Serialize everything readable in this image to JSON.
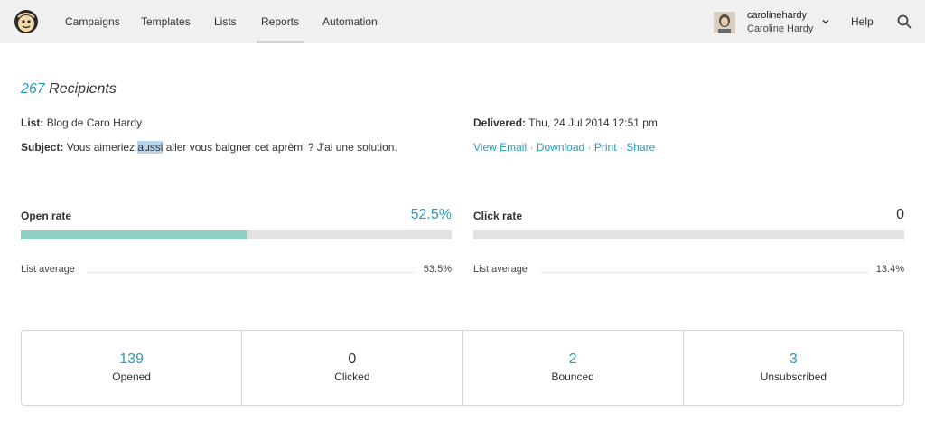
{
  "nav": {
    "items": [
      "Campaigns",
      "Templates",
      "Lists",
      "Reports",
      "Automation"
    ],
    "active": "Reports",
    "user_name": "carolinehardy",
    "user_full": "Caroline Hardy",
    "help": "Help"
  },
  "header": {
    "count": "267",
    "label": "Recipients",
    "list_label": "List:",
    "list_value": "Blog de Caro Hardy",
    "subject_label": "Subject:",
    "subject_before": "Vous aimeriez ",
    "subject_highlight": "aussi",
    "subject_after": " aller vous baigner cet aprèm' ? J'ai une solution.",
    "delivered_label": "Delivered:",
    "delivered_value": "Thu, 24 Jul 2014 12:51 pm",
    "links": [
      "View Email",
      "Download",
      "Print",
      "Share"
    ],
    "link_sep": "·"
  },
  "open_rate": {
    "label": "Open rate",
    "value": "52.5%",
    "fill": 0.525,
    "avg_label": "List average",
    "avg_value": "53.5%"
  },
  "click_rate": {
    "label": "Click rate",
    "value": "0",
    "fill": 0,
    "avg_label": "List average",
    "avg_value": "13.4%"
  },
  "stats": [
    {
      "value": "139",
      "label": "Opened",
      "color": "#2a9cb6"
    },
    {
      "value": "0",
      "label": "Clicked",
      "color": "#333333"
    },
    {
      "value": "2",
      "label": "Bounced",
      "color": "#2a9cb6"
    },
    {
      "value": "3",
      "label": "Unsubscribed",
      "color": "#2a9cb6"
    }
  ],
  "colors": {
    "accent": "#2a9cb6",
    "bar_fill": "#8fd0c4",
    "bar_bg": "#e2e2e2"
  }
}
